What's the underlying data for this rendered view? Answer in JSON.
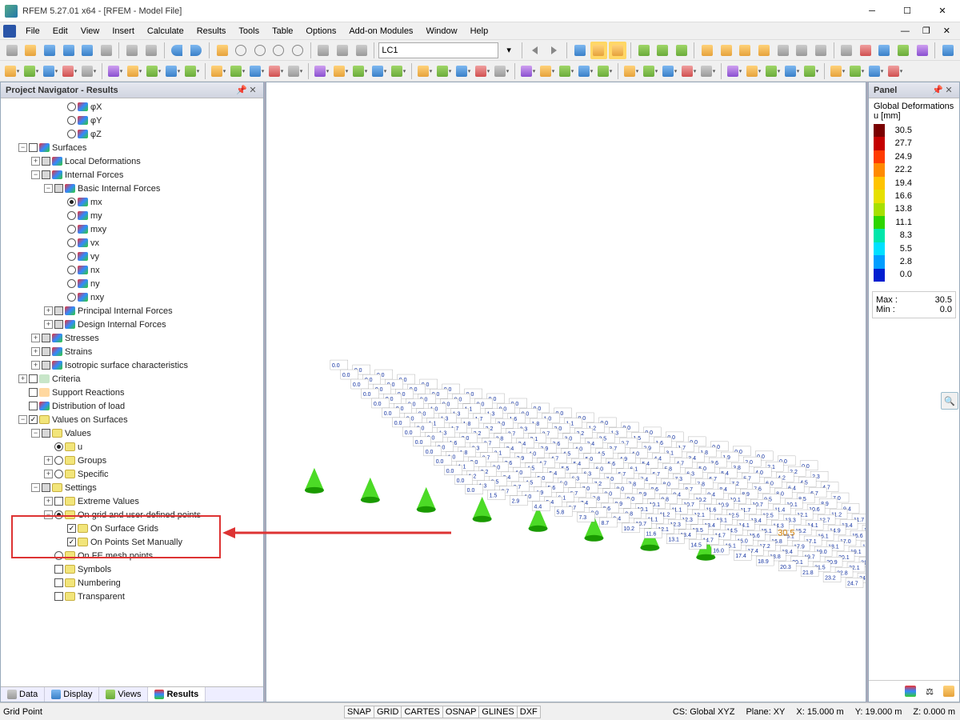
{
  "window": {
    "title": "RFEM 5.27.01 x64 - [RFEM - Model File]"
  },
  "menu": [
    "File",
    "Edit",
    "View",
    "Insert",
    "Calculate",
    "Results",
    "Tools",
    "Table",
    "Options",
    "Add-on Modules",
    "Window",
    "Help"
  ],
  "loadcase": "LC1",
  "navigator": {
    "title": "Project Navigator - Results",
    "tree": [
      {
        "ind": 4,
        "rb": false,
        "tic": "surf",
        "lbl": "φX"
      },
      {
        "ind": 4,
        "rb": false,
        "tic": "surf",
        "lbl": "φY"
      },
      {
        "ind": 4,
        "rb": false,
        "tic": "surf",
        "lbl": "φZ"
      },
      {
        "ind": 1,
        "pm": "-",
        "cb": false,
        "tic": "surf",
        "lbl": "Surfaces"
      },
      {
        "ind": 2,
        "pm": "+",
        "cb": "g",
        "tic": "surf",
        "lbl": "Local Deformations"
      },
      {
        "ind": 2,
        "pm": "-",
        "cb": "g",
        "tic": "surf",
        "lbl": "Internal Forces"
      },
      {
        "ind": 3,
        "pm": "-",
        "cb": "g",
        "tic": "surf",
        "lbl": "Basic Internal Forces"
      },
      {
        "ind": 4,
        "rb": true,
        "tic": "surf",
        "lbl": "mx"
      },
      {
        "ind": 4,
        "rb": false,
        "tic": "surf",
        "lbl": "my"
      },
      {
        "ind": 4,
        "rb": false,
        "tic": "surf",
        "lbl": "mxy"
      },
      {
        "ind": 4,
        "rb": false,
        "tic": "surf",
        "lbl": "vx"
      },
      {
        "ind": 4,
        "rb": false,
        "tic": "surf",
        "lbl": "vy"
      },
      {
        "ind": 4,
        "rb": false,
        "tic": "surf",
        "lbl": "nx"
      },
      {
        "ind": 4,
        "rb": false,
        "tic": "surf",
        "lbl": "ny"
      },
      {
        "ind": 4,
        "rb": false,
        "tic": "surf",
        "lbl": "nxy"
      },
      {
        "ind": 3,
        "pm": "+",
        "cb": "g",
        "tic": "surf",
        "lbl": "Principal Internal Forces"
      },
      {
        "ind": 3,
        "pm": "+",
        "cb": "g",
        "tic": "surf",
        "lbl": "Design Internal Forces"
      },
      {
        "ind": 2,
        "pm": "+",
        "cb": "g",
        "tic": "surf",
        "lbl": "Stresses"
      },
      {
        "ind": 2,
        "pm": "+",
        "cb": "g",
        "tic": "surf",
        "lbl": "Strains"
      },
      {
        "ind": 2,
        "pm": "+",
        "cb": "g",
        "tic": "surf",
        "lbl": "Isotropic surface characteristics"
      },
      {
        "ind": 1,
        "pm": "+",
        "cb": false,
        "tic": "g",
        "lbl": "Criteria"
      },
      {
        "ind": 1,
        "cb": false,
        "tic": "o",
        "lbl": "Support Reactions"
      },
      {
        "ind": 1,
        "cb": false,
        "tic": "surf",
        "lbl": "Distribution of load"
      },
      {
        "ind": 1,
        "pm": "-",
        "cb": true,
        "tic": "y",
        "lbl": "Values on Surfaces"
      },
      {
        "ind": 2,
        "pm": "-",
        "cb": "g",
        "tic": "y",
        "lbl": "Values"
      },
      {
        "ind": 3,
        "rb": true,
        "tic": "y",
        "lbl": "u"
      },
      {
        "ind": 3,
        "pm": "+",
        "rb": false,
        "tic": "y",
        "lbl": "Groups"
      },
      {
        "ind": 3,
        "pm": "+",
        "rb": false,
        "tic": "y",
        "lbl": "Specific"
      },
      {
        "ind": 2,
        "pm": "-",
        "cb": "g",
        "tic": "y",
        "lbl": "Settings"
      },
      {
        "ind": 3,
        "pm": "+",
        "cb": false,
        "tic": "y",
        "lbl": "Extreme Values"
      },
      {
        "ind": 3,
        "pm": "-",
        "rb": true,
        "tic": "y",
        "lbl": "On grid and user-defined points"
      },
      {
        "ind": 4,
        "cb": true,
        "tic": "y",
        "lbl": "On Surface Grids"
      },
      {
        "ind": 4,
        "cb": true,
        "tic": "y",
        "lbl": "On Points Set Manually"
      },
      {
        "ind": 3,
        "rb": false,
        "tic": "y",
        "lbl": "On FE mesh points"
      },
      {
        "ind": 3,
        "cb": false,
        "tic": "y",
        "lbl": "Symbols"
      },
      {
        "ind": 3,
        "cb": false,
        "tic": "y",
        "lbl": "Numbering"
      },
      {
        "ind": 3,
        "cb": false,
        "tic": "y",
        "lbl": "Transparent"
      }
    ],
    "tabs": [
      "Data",
      "Display",
      "Views",
      "Results"
    ],
    "active_tab": 3
  },
  "panel": {
    "title": "Panel",
    "legend_title": "Global Deformations",
    "legend_unit": "u [mm]",
    "legend_values": [
      "30.5",
      "27.7",
      "24.9",
      "22.2",
      "19.4",
      "16.6",
      "13.8",
      "11.1",
      "8.3",
      "5.5",
      "2.8",
      "0.0"
    ],
    "legend_colors": [
      "#7a0000",
      "#c40000",
      "#ff3b00",
      "#ff8a00",
      "#ffc400",
      "#e6e000",
      "#a6e000",
      "#2dd500",
      "#00e6aa",
      "#00e0ff",
      "#009dff",
      "#001ed0"
    ],
    "max_label": "Max  :",
    "max_value": "30.5",
    "min_label": "Min   :",
    "min_value": "0.0"
  },
  "statusbar": {
    "left": "Grid Point",
    "snap": [
      "SNAP",
      "GRID",
      "CARTES",
      "OSNAP",
      "GLINES",
      "DXF"
    ],
    "cs": "CS: Global XYZ",
    "plane": "Plane: XY",
    "x": "X:  15.000 m",
    "y": "Y:  19.000 m",
    "z": "Z:  0.000 m"
  },
  "viewport": {
    "max_label_value": "30.5"
  }
}
